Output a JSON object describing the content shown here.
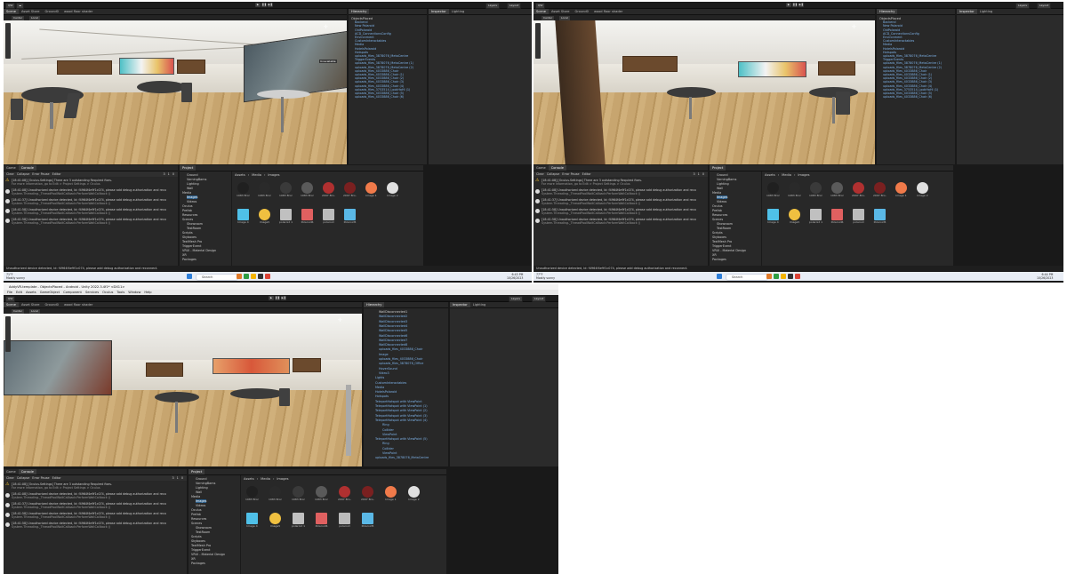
{
  "editor": {
    "toolbar": {
      "account": "QW",
      "layers": "Layers",
      "layout": "Layout"
    },
    "scene_tabs": [
      "Scene",
      "Asset Store",
      "Ground0",
      "wood floor shader"
    ],
    "scene_tools": {
      "center": "Center",
      "local": "Local"
    },
    "right_tabs": {
      "inspector": "Inspector",
      "lighting": "Lighting"
    },
    "hierarchy_tab": "Hierarchy",
    "bottom_tabs": {
      "game": "Game",
      "console": "Console",
      "project": "Project"
    },
    "console_toolbar": {
      "clear": "Clear",
      "collapse": "Collapse",
      "error_pause": "Error Pause",
      "editor": "Editor"
    },
    "console_counts": {
      "warnings": "1",
      "errors": "0",
      "infos": "3"
    },
    "console_lines": [
      {
        "text": "[18:41:08] [Oculus.Settings] There are 3 outstanding Required fixes.",
        "sub": "For more information, go to Edit > Project Settings > Oculus"
      },
      {
        "text": "[18:41:08] Unauthorized device detected, Id: f4964f4e9f1c074, please add debug authorization and reco",
        "sub": "System.Threading._ThreadPoolWaitCallback:PerformWaitCallback ()"
      },
      {
        "text": "[18:41:37] Unauthorized device detected, Id: f4964f4e9f1c074, please add debug authorization and reco",
        "sub": "System.Threading._ThreadPoolWaitCallback:PerformWaitCallback ()"
      },
      {
        "text": "[18:41:58] Unauthorized device detected, Id: f4964f4e9f1c074, please add debug authorization and reco",
        "sub": "System.Threading._ThreadPoolWaitCallback:PerformWaitCallback ()"
      },
      {
        "text": "[18:41:58] Unauthorized device detected, Id: f4964f4e9f1c074, please add debug authorization and reco",
        "sub": "System.Threading._ThreadPoolWaitCallback:PerformWaitCallback ()"
      }
    ],
    "status_message": "Unauthorized device detected, Id: f4964f4e9f1c074, please add debug authorization and reconnect.",
    "breadcrumb": [
      "Assets",
      "Media",
      "Images"
    ],
    "folders_a": [
      "Ground",
      "VarningBams",
      "Lighting",
      "Wall",
      "Media",
      "Images",
      "Videos",
      "Oculus",
      "Prefab",
      "Resources",
      "Scenes",
      "Showroom",
      "TestRoom",
      "Scripts",
      "Skyboxes",
      "TextMesh Pro",
      "TriggerEvent",
      "VRUI - Material Design",
      "XR",
      "Packages"
    ],
    "assets": [
      {
        "label": "1983 Bronze",
        "color": "#202020"
      },
      {
        "label": "1983 Bronze",
        "color": "#2a2a2a"
      },
      {
        "label": "1983 Bronze",
        "color": "#3a3a3a"
      },
      {
        "label": "1983 Bronze",
        "color": "#5a5a5a"
      },
      {
        "label": "2097 Bro...",
        "color": "#b03030"
      },
      {
        "label": "2097 Bro...",
        "color": "#7a2020"
      },
      {
        "label": "Image 1",
        "color": "#f07a4a"
      },
      {
        "label": "Image 2",
        "color": "#e0e0e0"
      },
      {
        "label": "Image 4",
        "color": "#4fc0e8"
      },
      {
        "label": "Image5",
        "color": "#f0c040"
      },
      {
        "label": "polaroid 1",
        "color": "#c0c0c0"
      },
      {
        "label": "Polaroid6",
        "color": "#e06060"
      },
      {
        "label": "polaroid",
        "color": "#bbbbbb"
      },
      {
        "label": "Polaroid5",
        "color": "#5ab8e6"
      }
    ],
    "hierarchy_a": [
      "ObjectsPlaced",
      "Backend",
      "New Polaroid",
      "OldPolaroid",
      "ACD_ConnectionsConfig",
      "Environment",
      "CustomInteractables",
      "Media",
      "HotelsPolaroid",
      "Hotspots",
      "uploads_files_3878076_MetaCentre",
      "TriggerEvents",
      "uploads_files_3878076_MetaCentre (1)",
      "uploads_files_3878076_MetaCentre (2)",
      "uploads_files_4033886_Chair",
      "uploads_files_4033886_Chair (1)",
      "uploads_files_4033886_Chair (2)",
      "uploads_files_4033886_Chair (3)",
      "uploads_files_4033886_Chair (4)",
      "uploads_files_3753514_LookHaHl (1)",
      "uploads_files_4033886_Chair (5)",
      "uploads_files_4033886_Chair (6)"
    ],
    "hierarchy_c": [
      "WallDisconnected1",
      "WallDisconnected2",
      "WallDisconnected3",
      "WallDisconnected4",
      "WallDisconnected5",
      "WallDisconnected6",
      "WallDisconnected7",
      "WallDisconnected8",
      "uploads_files_4033886_Chair",
      "Image",
      "uploads_files_4033886_Chair",
      "uploads_files_3878076_Office",
      "HoverSound",
      "Video3",
      "Lights",
      "CustomInteractables",
      "Media",
      "HotelsPolaroid",
      "Hotspots",
      "TeleportHotspot with ViewPoint",
      "TeleportHotspot with ViewPoint (1)",
      "TeleportHotspot with ViewPoint (2)",
      "TeleportHotspot with ViewPoint (3)",
      "TeleportHotspot with ViewPoint (4)",
      "Ring",
      "Collider",
      "ViewPoint",
      "TeleportHotspot with ViewPoint (5)",
      "Ring",
      "Collider",
      "ViewPoint",
      "uploads_files_3878076_MetaCentre"
    ],
    "window_title": "AddyVR-template - ObjectsPlaced - Android - Unity 2022.3.4f1* <DX11>",
    "menus": [
      "File",
      "Edit",
      "Assets",
      "GameObject",
      "Component",
      "Services",
      "Oculus",
      "Tools",
      "Window",
      "Help"
    ],
    "scene_label": "Unavailable"
  },
  "taskbar": {
    "weather_a": {
      "temp": "71°F",
      "cond": "Mostly sunny"
    },
    "weather_b": {
      "temp": "77°F",
      "cond": "Mostly sunny"
    },
    "search": "Search",
    "clock_a": {
      "time": "6:43 PM",
      "date": "10/26/2023"
    },
    "clock_b": {
      "time": "6:44 PM",
      "date": "10/26/2023"
    }
  }
}
